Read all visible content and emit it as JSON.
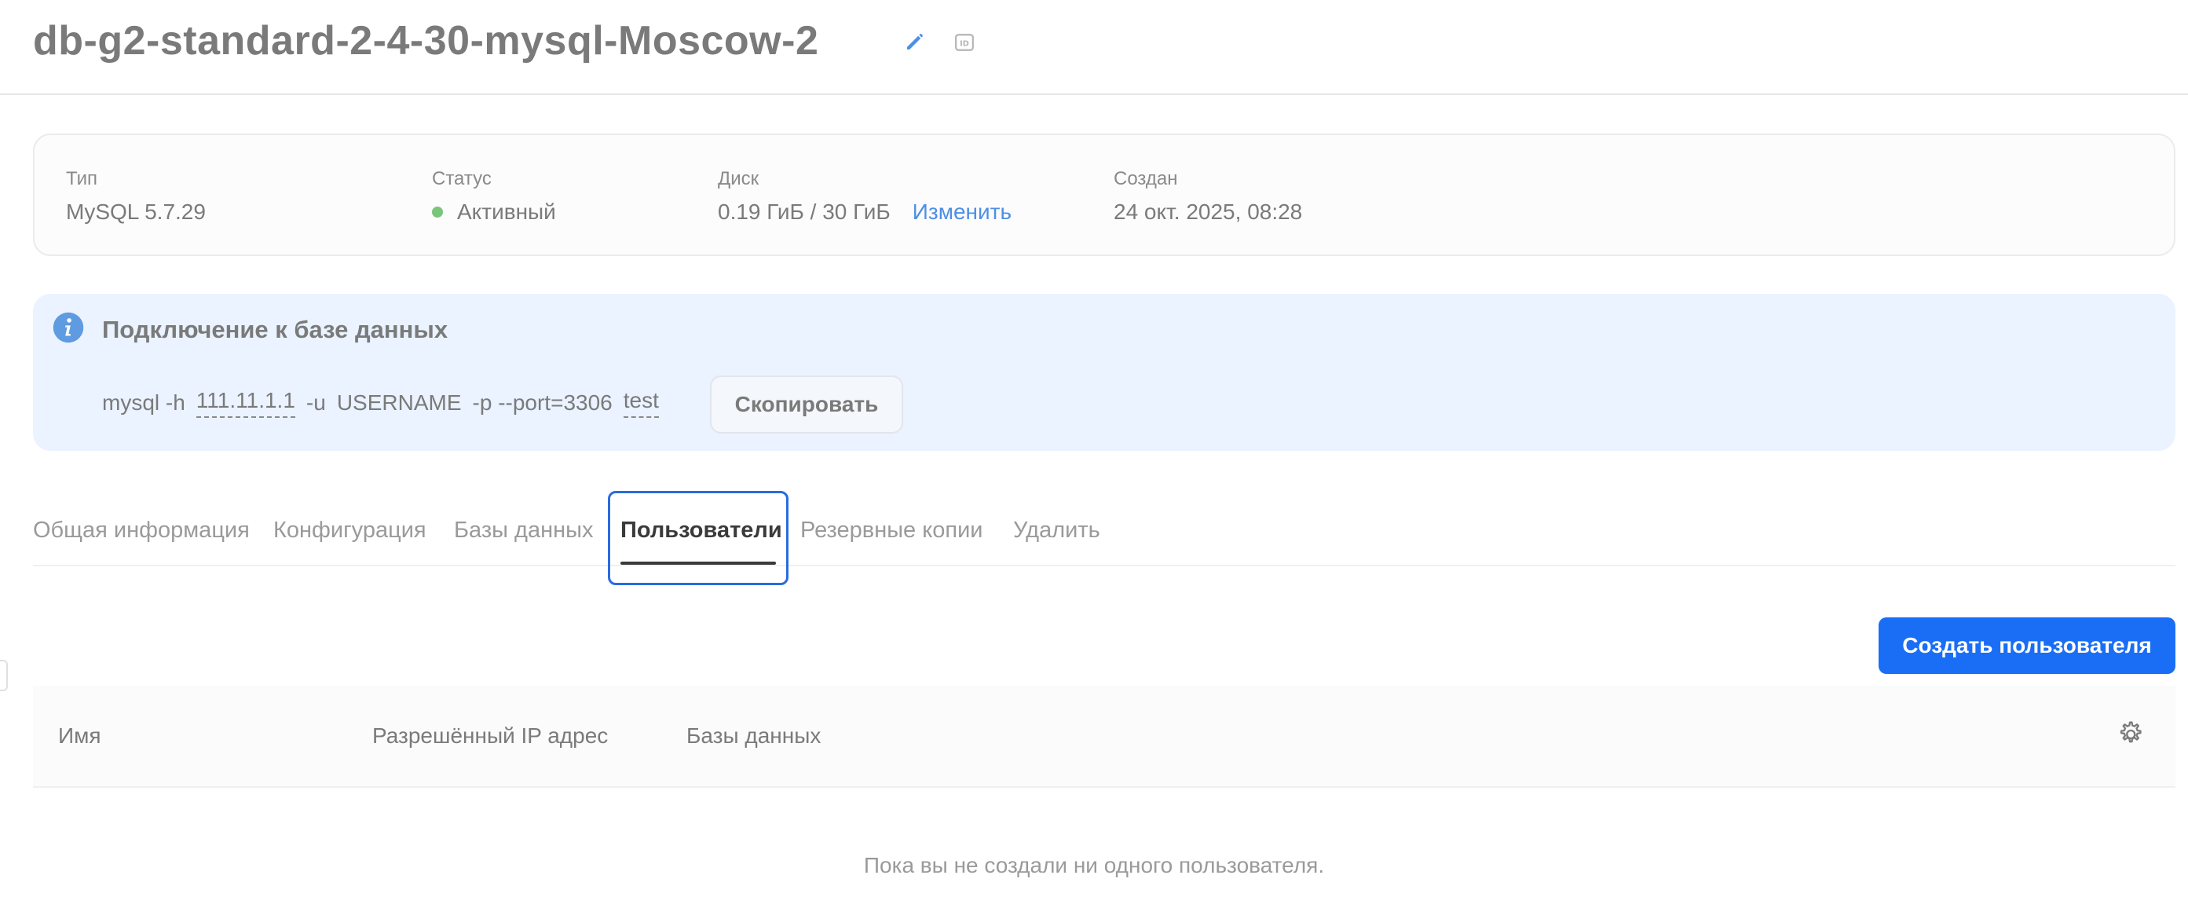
{
  "header": {
    "title": "db-g2-standard-2-4-30-mysql-Moscow-2",
    "icons": {
      "edit": "edit-icon",
      "id": "id-icon"
    }
  },
  "info": {
    "type_label": "Тип",
    "type_value": "MySQL 5.7.29",
    "status_label": "Статус",
    "status_value": "Активный",
    "disk_label": "Диск",
    "disk_value": "0.19 ГиБ / 30 ГиБ",
    "disk_action": "Изменить",
    "created_label": "Создан",
    "created_value": "24 окт. 2025, 08:28"
  },
  "connection": {
    "title": "Подключение к базе данных",
    "cmd_prefix": "mysql -h",
    "host": "111.11.1.1",
    "user_flag": "-u",
    "username": "USERNAME",
    "rest": "-p --port=3306",
    "database": "test",
    "copy_label": "Скопировать"
  },
  "tabs": [
    {
      "label": "Общая информация"
    },
    {
      "label": "Конфигурация"
    },
    {
      "label": "Базы данных"
    },
    {
      "label": "Пользователи",
      "active": true
    },
    {
      "label": "Резервные копии"
    },
    {
      "label": "Удалить"
    }
  ],
  "users": {
    "create_label": "Создать пользователя",
    "columns": [
      "Имя",
      "Разрешённый IP адрес",
      "Базы данных"
    ],
    "empty_message": "Пока вы не создали ни одного пользователя."
  },
  "colors": {
    "accent": "#1a6ef5",
    "link": "#4d8fe6",
    "status_active": "#79c57a",
    "info_bg": "#eaf3ff"
  }
}
